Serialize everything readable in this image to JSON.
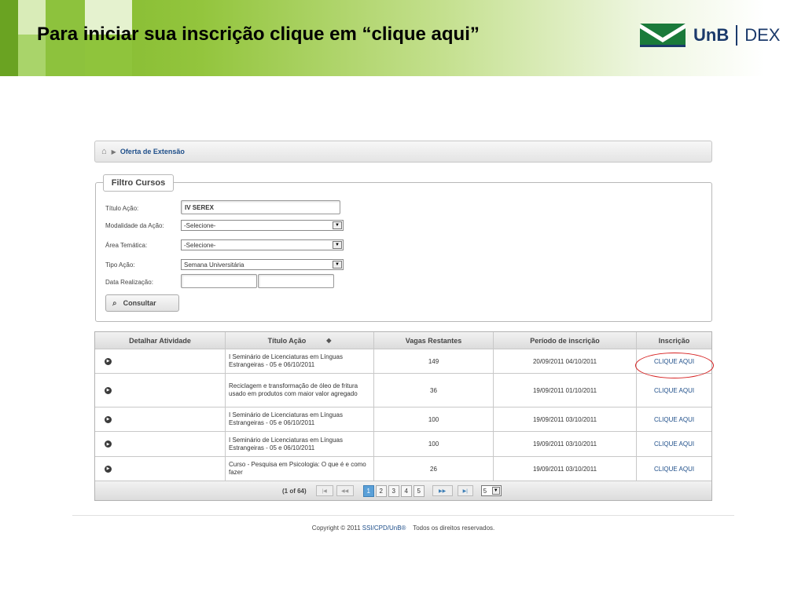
{
  "slide": {
    "title": "Para iniciar sua inscrição clique em “clique aqui”",
    "logo_unb": "UnB",
    "logo_dex": "DEX"
  },
  "breadcrumb": {
    "current": "Oferta de Extensão"
  },
  "filter": {
    "legend": "Filtro Cursos",
    "titulo_label": "Título Ação:",
    "titulo_value": "IV SEREX",
    "modalidade_label": "Modalidade da Ação:",
    "modalidade_value": "-Selecione-",
    "area_label": "Área Temática:",
    "area_value": "-Selecione-",
    "tipo_label": "Tipo Ação:",
    "tipo_value": "Semana Universitária",
    "data_label": "Data Realização:",
    "data_inicio": "",
    "data_fim": "",
    "consultar_label": "Consultar"
  },
  "table": {
    "headers": [
      "Detalhar Atividade",
      "Título Ação",
      "Vagas Restantes",
      "Período de inscrição",
      "Inscrição"
    ],
    "rows": [
      {
        "titulo": "I Seminário de Licenciaturas em Línguas Estrangeiras - 05 e 06/10/2011",
        "vagas": "149",
        "periodo": "20/09/2011  04/10/2011",
        "inscricao": "CLIQUE AQUI"
      },
      {
        "titulo": "Reciclagem e transformação de óleo de fritura usado em produtos com maior valor agregado",
        "vagas": "36",
        "periodo": "19/09/2011  01/10/2011",
        "inscricao": "CLIQUE AQUI"
      },
      {
        "titulo": "I Seminário de Licenciaturas em Línguas Estrangeiras - 05 e 06/10/2011",
        "vagas": "100",
        "periodo": "19/09/2011  03/10/2011",
        "inscricao": "CLIQUE AQUI"
      },
      {
        "titulo": "I Seminário de Licenciaturas em Línguas Estrangeiras - 05 e 06/10/2011",
        "vagas": "100",
        "periodo": "19/09/2011  03/10/2011",
        "inscricao": "CLIQUE AQUI"
      },
      {
        "titulo": "Curso - Pesquisa em Psicologia: O que é e como fazer",
        "vagas": "26",
        "periodo": "19/09/2011  03/10/2011",
        "inscricao": "CLIQUE AQUI"
      }
    ]
  },
  "pager": {
    "count": "(1 of 64)",
    "pages": [
      "1",
      "2",
      "3",
      "4",
      "5"
    ],
    "rows_per_page": "5"
  },
  "footer": {
    "prefix": "Copyright © 2011",
    "link": "SSI/CPD/UnB®",
    "suffix": "Todos os direitos reservados."
  },
  "colors": {
    "accent_green": "#7cb52a",
    "link_blue": "#1f4f8a",
    "highlight_red": "#d62020"
  }
}
